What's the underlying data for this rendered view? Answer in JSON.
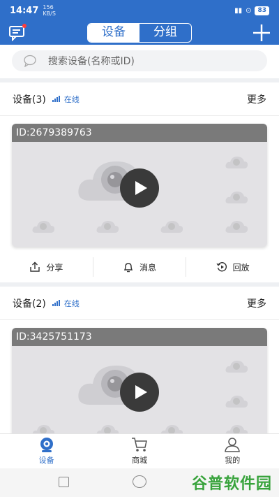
{
  "status_bar": {
    "time": "14:47",
    "net_speed": "156",
    "net_unit": "KB/S",
    "battery": "83"
  },
  "header": {
    "tabs": [
      "设备",
      "分组"
    ],
    "active_tab": 0
  },
  "search": {
    "placeholder": "搜索设备(名称或ID)"
  },
  "devices": [
    {
      "title": "设备(3)",
      "status": "在线",
      "more": "更多",
      "id_label": "ID:2679389763"
    },
    {
      "title": "设备(2)",
      "status": "在线",
      "more": "更多",
      "id_label": "ID:3425751173"
    }
  ],
  "actions": {
    "share": "分享",
    "message": "消息",
    "playback": "回放"
  },
  "tabbar": {
    "items": [
      "设备",
      "商城",
      "我的"
    ],
    "active": 0
  },
  "watermark": {
    "text": "谷普软件园"
  },
  "colors": {
    "accent": "#2f6fc9",
    "online": "#2f6fc9",
    "badge": "#ff3b3b"
  }
}
